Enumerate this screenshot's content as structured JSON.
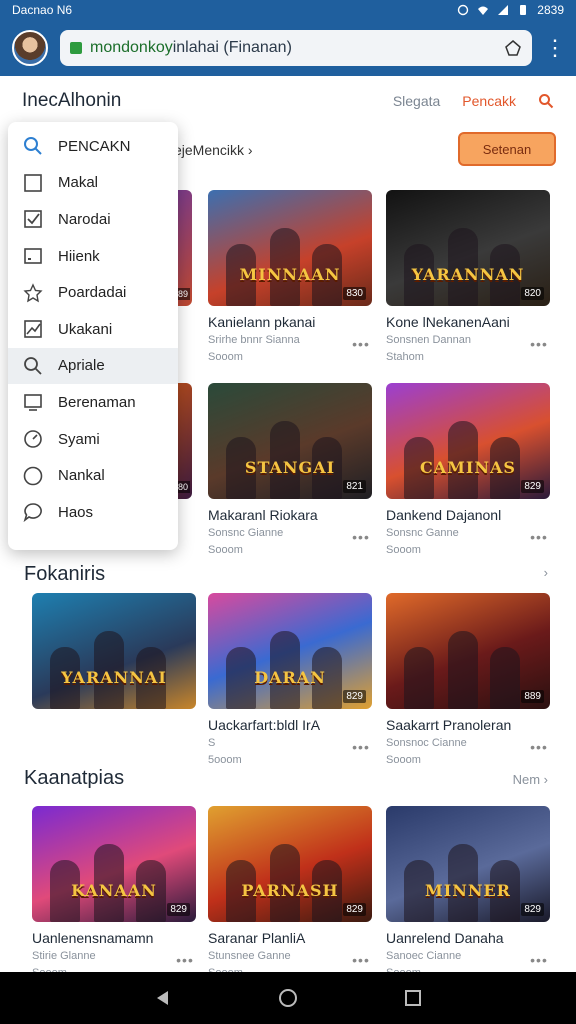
{
  "status": {
    "left": "Dacnao  N6",
    "time": "2839"
  },
  "browser": {
    "url_prefix": "mondonkoy",
    "url_rest": "inlahai (Finanan)"
  },
  "header": {
    "brand": "InecAlhonin",
    "nav": [
      "Slegata",
      "Pencakk"
    ]
  },
  "filter": {
    "crumb": "ejeMencikk ›",
    "cta": "Setenan"
  },
  "dropdown": [
    {
      "label": "PENCAKN",
      "icon": "search-icon"
    },
    {
      "label": "Makal",
      "icon": "square-icon"
    },
    {
      "label": "Narodai",
      "icon": "checkbox-icon"
    },
    {
      "label": "Hiienk",
      "icon": "rect-icon"
    },
    {
      "label": "Poardadai",
      "icon": "star-icon"
    },
    {
      "label": "Ukakani",
      "icon": "chart-icon"
    },
    {
      "label": "Apriale",
      "icon": "search-icon"
    },
    {
      "label": "Berenaman",
      "icon": "screen-icon"
    },
    {
      "label": "Syami",
      "icon": "gauge-icon"
    },
    {
      "label": "Nankal",
      "icon": "circle-icon"
    },
    {
      "label": "Haos",
      "icon": "chat-icon"
    }
  ],
  "sections": [
    {
      "title": "Fokaniris",
      "link": "›"
    },
    {
      "title": "Kaanatpias",
      "link": "Nem ›"
    }
  ],
  "cards": [
    {
      "title": "Kanielann pkanai",
      "meta1": "Srirhe bnnr Sianna",
      "meta2": "Sooom",
      "art": "MINNAAN",
      "dur": "830"
    },
    {
      "title": "Kone lNekanenAani",
      "meta1": "Sonsnen Dannan",
      "meta2": "Stahom",
      "art": "YARANNAN",
      "dur": "820"
    },
    {
      "title": "Makaranl Riokara",
      "meta1": "Sonsnc Gianne",
      "meta2": "Sooom",
      "art": "STANGAI",
      "dur": "821"
    },
    {
      "title": "Dankend Dajanonl",
      "meta1": "Sonsnc Ganne",
      "meta2": "Sooom",
      "art": "CAMINAS",
      "dur": "829"
    },
    {
      "title": "",
      "meta1": "",
      "meta2": "",
      "art": "YARANNAI",
      "dur": ""
    },
    {
      "title": "Uackarfart:bldl IrA",
      "meta1": "S",
      "meta2": "5ooom",
      "art": "DARAN",
      "dur": "829"
    },
    {
      "title": "Saakarrt Pranoleran",
      "meta1": "Sonsnoc Cianne",
      "meta2": "Sooom",
      "art": "",
      "dur": "889"
    },
    {
      "title": "Uanlenensnamamn",
      "meta1": "Stirie Glanne",
      "meta2": "Sooom",
      "art": "KANAAN",
      "dur": "829"
    },
    {
      "title": "Saranar PlanliA",
      "meta1": "Stunsnee Ganne",
      "meta2": "Sooom",
      "art": "PARNASH",
      "dur": "829"
    },
    {
      "title": "Uanrelend Danaha",
      "meta1": "Sanoec Cianne",
      "meta2": "Sooom",
      "art": "MINNER",
      "dur": "829"
    }
  ],
  "partials": [
    {
      "dur": "89"
    },
    {
      "dur": "80"
    }
  ]
}
